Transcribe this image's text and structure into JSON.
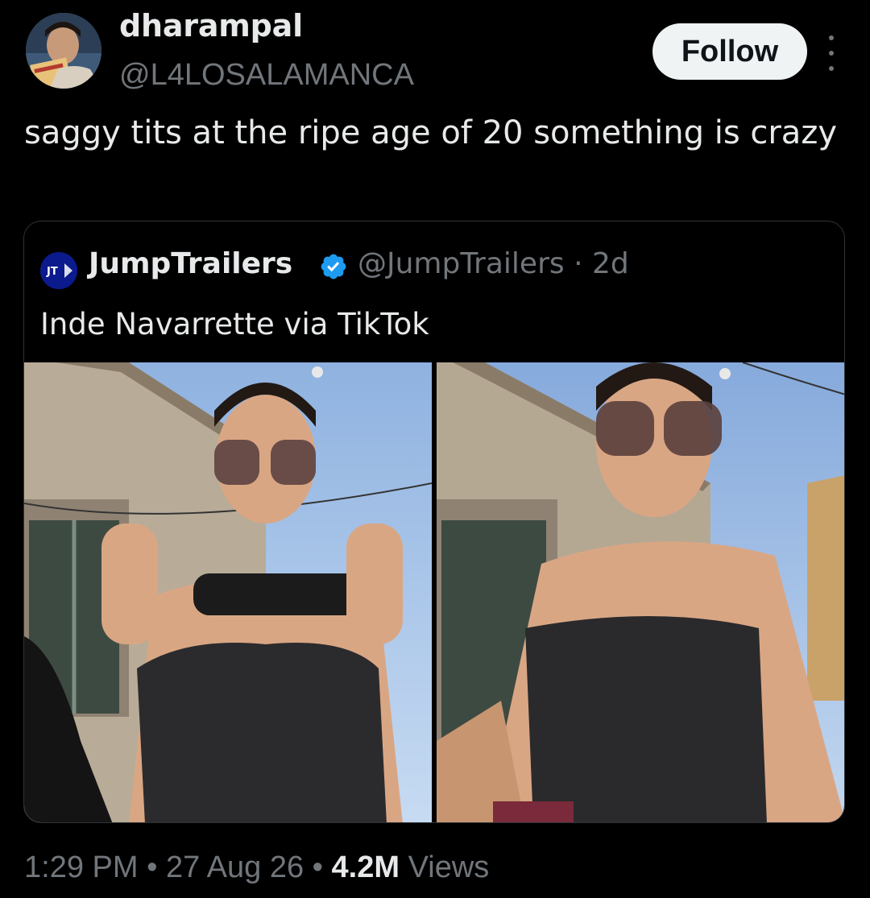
{
  "author": {
    "display_name": "dharampal",
    "handle": "@L4LOSALAMANCA",
    "avatar_icon": "profile-photo"
  },
  "actions": {
    "follow_label": "Follow",
    "more_icon": "more-vertical-icon"
  },
  "post": {
    "text": "saggy tits at the ripe age of 20 something is crazy"
  },
  "quoted_post": {
    "avatar_text": "JT",
    "display_name": "JumpTrailers",
    "verified": true,
    "handle_and_time": "@JumpTrailers · 2d",
    "text": "Inde Navarrette via TikTok",
    "media_count": 2
  },
  "meta": {
    "time": "1:29 PM",
    "sep1": " • ",
    "date": "27 Aug 26",
    "sep2": " • ",
    "views_count": "4.2M",
    "views_label": " Views"
  },
  "colors": {
    "background": "#000000",
    "primary_text": "#e7e9ea",
    "secondary_text": "#71767b",
    "follow_bg": "#eff3f4",
    "verified_blue": "#1d9bf0",
    "border": "#2f3336"
  }
}
